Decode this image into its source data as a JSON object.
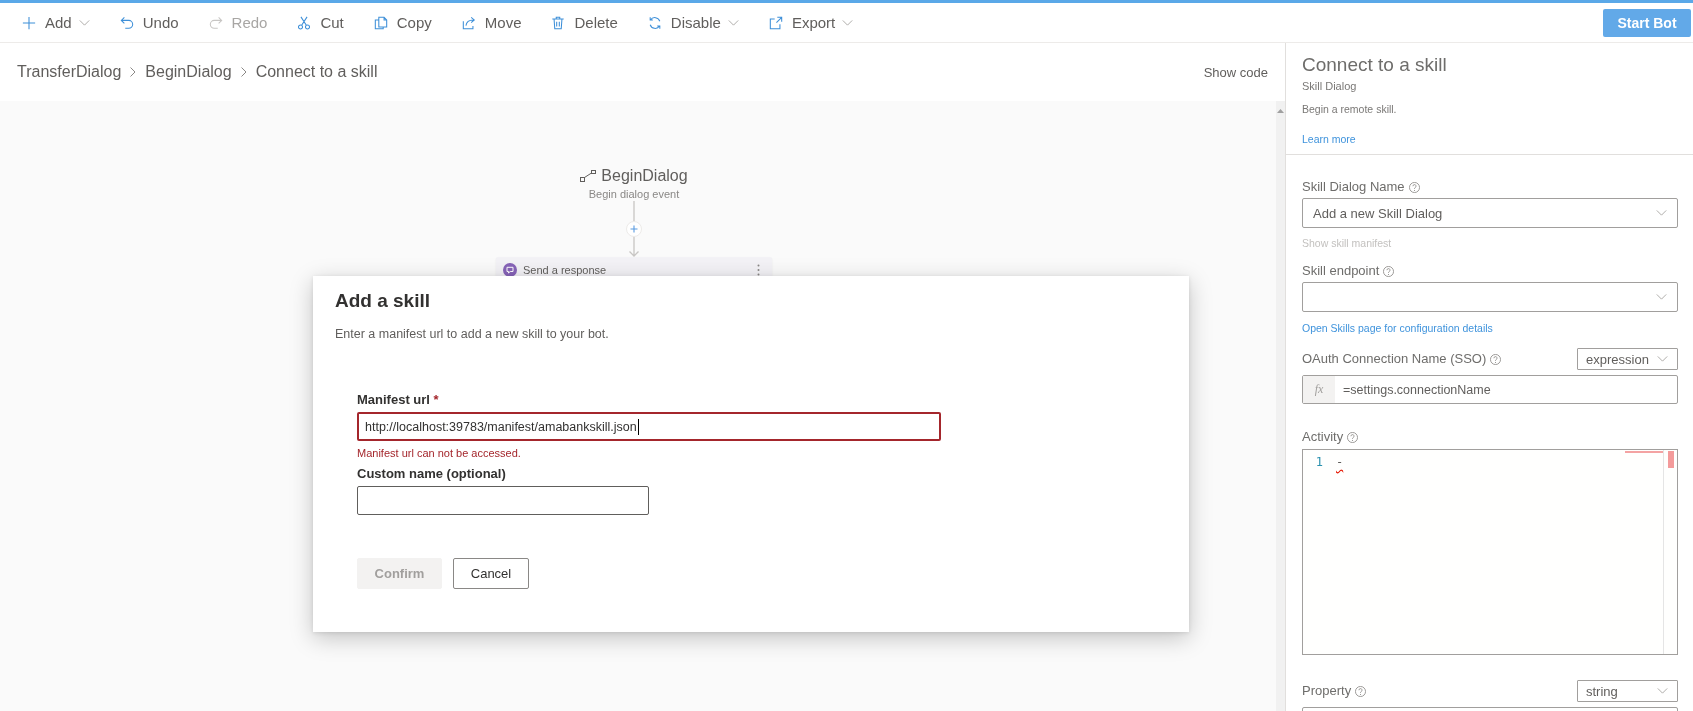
{
  "toolbar": {
    "items": [
      {
        "label": "Add",
        "dropdown": true,
        "disabled": false
      },
      {
        "label": "Undo",
        "dropdown": false,
        "disabled": false
      },
      {
        "label": "Redo",
        "dropdown": false,
        "disabled": true
      },
      {
        "label": "Cut",
        "dropdown": false,
        "disabled": false
      },
      {
        "label": "Copy",
        "dropdown": false,
        "disabled": false
      },
      {
        "label": "Move",
        "dropdown": false,
        "disabled": false
      },
      {
        "label": "Delete",
        "dropdown": false,
        "disabled": false
      },
      {
        "label": "Disable",
        "dropdown": true,
        "disabled": false
      },
      {
        "label": "Export",
        "dropdown": true,
        "disabled": false
      }
    ],
    "start_button": "Start Bot"
  },
  "breadcrumb": {
    "items": [
      "TransferDialog",
      "BeginDialog",
      "Connect to a skill"
    ],
    "show_code": "Show code"
  },
  "canvas": {
    "trigger": {
      "title": "BeginDialog",
      "subtitle": "Begin dialog event"
    },
    "actions": [
      {
        "label": "Send a response"
      }
    ]
  },
  "dialog": {
    "title": "Add a skill",
    "description": "Enter a manifest url to add a new skill to your bot.",
    "fields": [
      {
        "label": "Manifest url",
        "required_mark": "*",
        "value": "http://localhost:39783/manifest/amabankskill.json",
        "error": "Manifest url can not be accessed.",
        "focused": true
      },
      {
        "label": "Custom name (optional)",
        "focused": false
      }
    ],
    "buttons": [
      {
        "label": "Confirm",
        "kind": "primary",
        "disabled": true
      },
      {
        "label": "Cancel",
        "kind": "default",
        "disabled": false
      }
    ]
  },
  "properties": {
    "title": "Connect to a skill",
    "subtitle": "Skill Dialog",
    "description": "Begin a remote skill.",
    "link": "Learn more",
    "fields": [
      {
        "kind": "dropdown",
        "label": "Skill Dialog Name",
        "value": "Add a new Skill Dialog",
        "hint": "Show skill manifest"
      },
      {
        "kind": "dropdown",
        "label": "Skill endpoint",
        "link": "Open Skills page for configuration details"
      },
      {
        "kind": "typed",
        "label": "OAuth Connection Name (SSO)",
        "type": "expression",
        "prefix": "fx",
        "value": "=settings.connectionName"
      },
      {
        "kind": "code",
        "label": "Activity",
        "lines": [
          {
            "number": "1",
            "text": "-",
            "error": true
          }
        ]
      },
      {
        "kind": "typed",
        "label": "Property",
        "type": "string"
      }
    ]
  }
}
